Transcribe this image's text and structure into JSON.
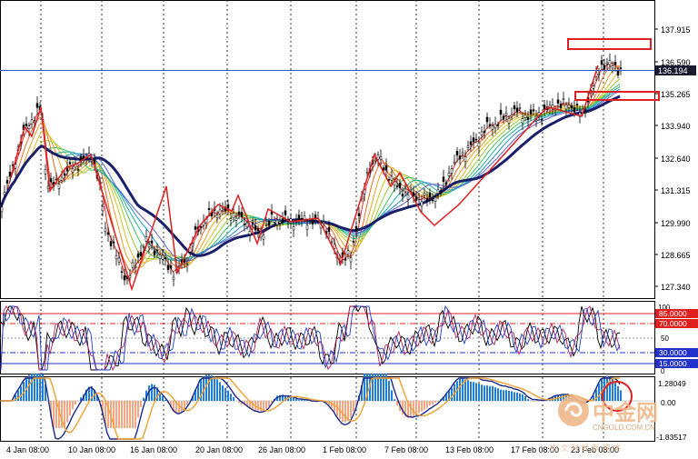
{
  "price_panel": {
    "axis_labels": [
      "137.915",
      "136.590",
      "135.265",
      "133.940",
      "132.640",
      "131.315",
      "129.990",
      "128.665",
      "127.340"
    ],
    "current_price": "136.194",
    "colors": {
      "current_line": "#3355cc",
      "current_tag_bg": "#1a1a2e",
      "ribbon_slow": "#1b1f6b"
    }
  },
  "rsi_panel": {
    "axis_labels": {
      "top": "100",
      "mid": "50",
      "bottom": "0"
    },
    "levels": [
      {
        "label": "85.0000",
        "value": 85,
        "color": "#e02020"
      },
      {
        "label": "70.0000",
        "value": 70,
        "color": "#e02020"
      },
      {
        "label": "30.0000",
        "value": 30,
        "color": "#2233cc"
      },
      {
        "label": "15.0000",
        "value": 15,
        "color": "#2233cc"
      }
    ]
  },
  "macd_panel": {
    "axis_labels": [
      "1.28049",
      "0.00",
      "-1.83517"
    ],
    "colors": {
      "positive": "#1e7fd8",
      "negative": "#f4a582",
      "main": "#1e2a8c",
      "signal": "#f0a030"
    }
  },
  "time_axis": [
    "4 Jan 08:00",
    "10 Jan 08:00",
    "16 Jan 08:00",
    "20 Jan 08:00",
    "26 Jan 08:00",
    "1 Feb 08:00",
    "7 Feb 08:00",
    "13 Feb 08:00",
    "17 Feb 08:00",
    "23 Feb 08:00"
  ],
  "watermark": {
    "brand": "中金网",
    "url": "CNGOLD.COM.CN",
    "slogan": "中 文 财 经 新 媒 体"
  }
}
